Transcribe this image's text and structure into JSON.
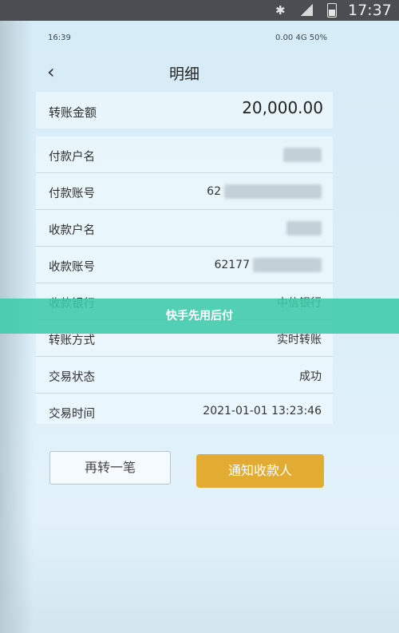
{
  "outer_status": {
    "time": "17:37",
    "icons": [
      "bluetooth-icon",
      "signal-icon",
      "battery-icon"
    ]
  },
  "inner_status": {
    "time_left": "16:39",
    "right_text": "0.00 4G 50%"
  },
  "header": {
    "title": "明细",
    "back_icon": "chevron-left-icon"
  },
  "amount": {
    "label": "转账金额",
    "value": "20,000.00"
  },
  "details": {
    "payer_name": {
      "label": "付款户名",
      "value": ""
    },
    "payer_account": {
      "label": "付款账号",
      "value": "62"
    },
    "payee_name": {
      "label": "收款户名",
      "value": ""
    },
    "payee_account": {
      "label": "收款账号",
      "value": "62177"
    },
    "payee_bank": {
      "label": "收款银行",
      "value": "中信银行"
    },
    "transfer_method": {
      "label": "转账方式",
      "value": "实时转账"
    },
    "status": {
      "label": "交易状态",
      "value": "成功"
    },
    "time": {
      "label": "交易时间",
      "value": "2021-01-01 13:23:46"
    }
  },
  "actions": {
    "again_label": "再转一笔",
    "notify_label": "通知收款人"
  },
  "banner": {
    "text": "快手先用后付"
  },
  "colors": {
    "accent": "#e2ac33",
    "banner": "#3ecba8"
  }
}
